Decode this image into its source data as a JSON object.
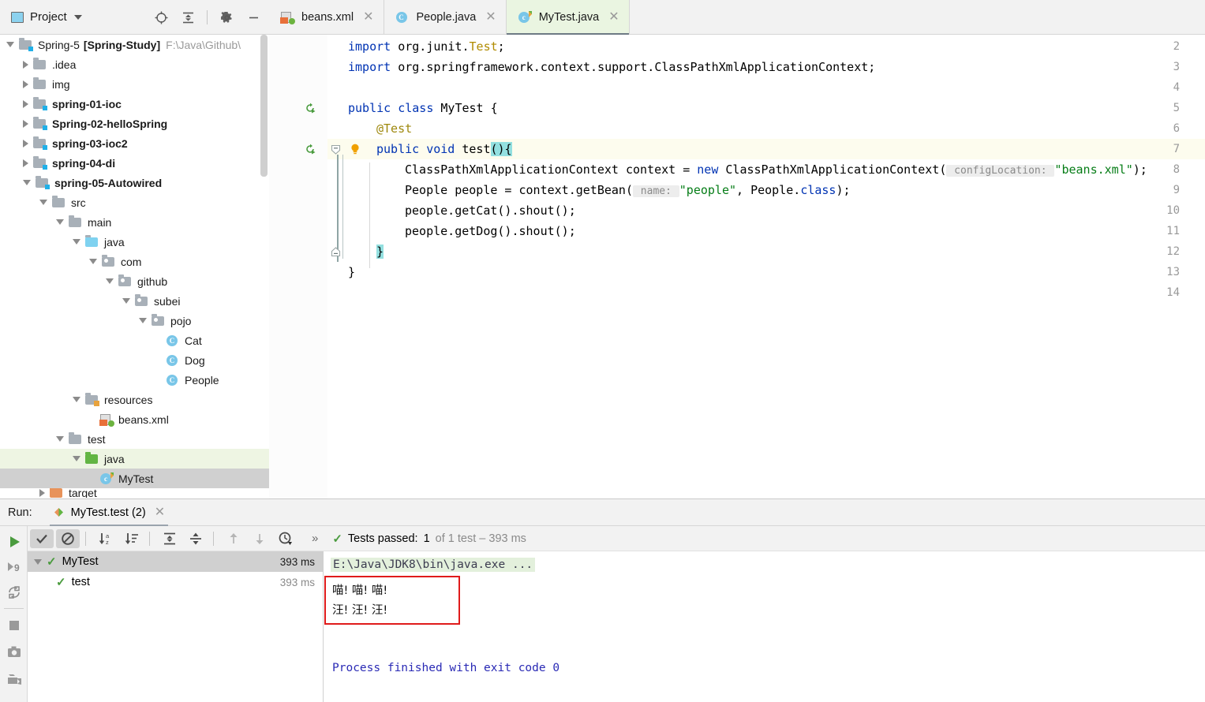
{
  "project_panel": {
    "title": "Project",
    "icons": [
      "locate-icon",
      "collapse-all-icon",
      "gear-icon",
      "minimize-icon"
    ],
    "tree": [
      {
        "depth": 0,
        "label": "Spring-5",
        "bold_label": "[Spring-Study]",
        "path": "F:\\Java\\Github\\",
        "icon": "module-folder",
        "expanded": true
      },
      {
        "depth": 1,
        "label": ".idea",
        "icon": "folder-gray",
        "expanded": false
      },
      {
        "depth": 1,
        "label": "img",
        "icon": "folder-gray",
        "expanded": false
      },
      {
        "depth": 1,
        "label": "spring-01-ioc",
        "icon": "module-folder",
        "expanded": false,
        "bold": true
      },
      {
        "depth": 1,
        "label": "Spring-02-helloSpring",
        "icon": "module-folder",
        "expanded": false,
        "bold": true
      },
      {
        "depth": 1,
        "label": "spring-03-ioc2",
        "icon": "module-folder",
        "expanded": false,
        "bold": true
      },
      {
        "depth": 1,
        "label": "spring-04-di",
        "icon": "module-folder",
        "expanded": false,
        "bold": true
      },
      {
        "depth": 1,
        "label": "spring-05-Autowired",
        "icon": "module-folder",
        "expanded": true,
        "bold": true
      },
      {
        "depth": 2,
        "label": "src",
        "icon": "folder-gray",
        "expanded": true
      },
      {
        "depth": 3,
        "label": "main",
        "icon": "folder-gray",
        "expanded": true
      },
      {
        "depth": 4,
        "label": "java",
        "icon": "folder-source-blue",
        "expanded": true
      },
      {
        "depth": 5,
        "label": "com",
        "icon": "package-icon",
        "expanded": true
      },
      {
        "depth": 6,
        "label": "github",
        "icon": "package-icon",
        "expanded": true
      },
      {
        "depth": 7,
        "label": "subei",
        "icon": "package-icon",
        "expanded": true
      },
      {
        "depth": 8,
        "label": "pojo",
        "icon": "package-icon",
        "expanded": true
      },
      {
        "depth": 9,
        "label": "Cat",
        "icon": "class-icon"
      },
      {
        "depth": 9,
        "label": "Dog",
        "icon": "class-icon"
      },
      {
        "depth": 9,
        "label": "People",
        "icon": "class-icon"
      },
      {
        "depth": 4,
        "label": "resources",
        "icon": "folder-resources",
        "expanded": true
      },
      {
        "depth": 5,
        "label": "beans.xml",
        "icon": "spring-xml-icon"
      },
      {
        "depth": 3,
        "label": "test",
        "icon": "folder-gray",
        "expanded": true
      },
      {
        "depth": 4,
        "label": "java",
        "icon": "folder-test-green",
        "expanded": true,
        "highlight": "light"
      },
      {
        "depth": 5,
        "label": "MyTest",
        "icon": "test-class-icon",
        "highlight": "selected"
      },
      {
        "depth": 2,
        "label": "target",
        "icon": "folder-excluded-orange",
        "expanded": false,
        "clipped": true
      }
    ]
  },
  "editor": {
    "tabs": [
      {
        "label": "beans.xml",
        "icon": "spring-xml-icon",
        "active": false,
        "closable": true
      },
      {
        "label": "People.java",
        "icon": "class-icon",
        "active": false,
        "closable": true
      },
      {
        "label": "MyTest.java",
        "icon": "test-class-icon",
        "active": true,
        "closable": true
      }
    ],
    "first_line_number": 2,
    "lines": [
      {
        "n": 2,
        "indent": 0,
        "tokens": [
          {
            "t": "import ",
            "c": "kw"
          },
          {
            "t": "org.junit.",
            "c": "plain"
          },
          {
            "t": "Test",
            "c": "typ"
          },
          {
            "t": ";",
            "c": "plain"
          }
        ]
      },
      {
        "n": 3,
        "indent": 0,
        "tokens": [
          {
            "t": "import ",
            "c": "kw"
          },
          {
            "t": "org.springframework.context.support.ClassPathXmlApplicationContext;",
            "c": "plain"
          }
        ]
      },
      {
        "n": 4,
        "indent": 0,
        "tokens": []
      },
      {
        "n": 5,
        "indent": 0,
        "tokens": [
          {
            "t": "public ",
            "c": "kw"
          },
          {
            "t": "class ",
            "c": "kw"
          },
          {
            "t": "MyTest {",
            "c": "plain"
          }
        ],
        "gutter_icon": "run-class-icon"
      },
      {
        "n": 6,
        "indent": 1,
        "tokens": [
          {
            "t": "@Test",
            "c": "ann"
          }
        ]
      },
      {
        "n": 7,
        "indent": 1,
        "tokens": [
          {
            "t": "public ",
            "c": "kw"
          },
          {
            "t": "void ",
            "c": "kw"
          },
          {
            "t": "test",
            "c": "plain"
          },
          {
            "t": "(){",
            "c": "brace"
          }
        ],
        "gutter_icon": "run-method-icon",
        "bulb": true,
        "caret": true,
        "fold": true
      },
      {
        "n": 8,
        "indent": 2,
        "tokens": [
          {
            "t": "ClassPathXmlApplicationContext context = ",
            "c": "plain"
          },
          {
            "t": "new ",
            "c": "kw"
          },
          {
            "t": "ClassPathXmlApplicationContext(",
            "c": "plain"
          },
          {
            "t": " configLocation: ",
            "c": "hint"
          },
          {
            "t": "\"beans.xml\"",
            "c": "str"
          },
          {
            "t": ");",
            "c": "plain"
          }
        ]
      },
      {
        "n": 9,
        "indent": 2,
        "tokens": [
          {
            "t": "People people = context.getBean(",
            "c": "plain"
          },
          {
            "t": " name: ",
            "c": "hint"
          },
          {
            "t": "\"people\"",
            "c": "str"
          },
          {
            "t": ", People.",
            "c": "plain"
          },
          {
            "t": "class",
            "c": "kw"
          },
          {
            "t": ");",
            "c": "plain"
          }
        ]
      },
      {
        "n": 10,
        "indent": 2,
        "tokens": [
          {
            "t": "people.getCat().shout();",
            "c": "plain"
          }
        ]
      },
      {
        "n": 11,
        "indent": 2,
        "tokens": [
          {
            "t": "people.getDog().shout();",
            "c": "plain"
          }
        ]
      },
      {
        "n": 12,
        "indent": 1,
        "tokens": [
          {
            "t": "}",
            "c": "brace"
          }
        ],
        "fold_end": true
      },
      {
        "n": 13,
        "indent": 0,
        "tokens": [
          {
            "t": "}",
            "c": "plain"
          }
        ]
      },
      {
        "n": 14,
        "indent": 0,
        "tokens": []
      }
    ]
  },
  "run_panel": {
    "label": "Run:",
    "tab_label": "MyTest.test (2)",
    "toolbar_icons": [
      "show-passed-icon",
      "show-ignored-icon",
      "sort-alphabetically-icon",
      "sort-by-duration-icon",
      "expand-all-icon",
      "collapse-all-icon",
      "prev-failed-icon",
      "next-failed-icon",
      "history-icon",
      "more-icon"
    ],
    "rail_icons": [
      "rerun-icon",
      "rerun-failed-icon",
      "toggle-auto-test-icon",
      "stop-icon",
      "screenshot-icon",
      "export-icon"
    ],
    "status": {
      "prefix": "Tests passed:",
      "count": "1",
      "suffix": "of 1 test – 393 ms"
    },
    "test_tree": [
      {
        "label": "MyTest",
        "time": "393 ms",
        "depth": 0,
        "selected": true,
        "expanded": true,
        "status": "passed"
      },
      {
        "label": "test",
        "time": "393 ms",
        "depth": 1,
        "selected": false,
        "status": "passed"
      }
    ],
    "console": {
      "command": "E:\\Java\\JDK8\\bin\\java.exe ...",
      "output_lines": [
        "喵! 喵! 喵!",
        "汪! 汪! 汪!"
      ],
      "exit_line": "Process finished with exit code 0",
      "highlight_color": "#e01b1b"
    }
  },
  "colors": {
    "accent_green": "#62b543",
    "keyword_blue": "#0033b3",
    "string_green": "#067d17",
    "annotation_gold": "#9e880d",
    "selection_gray": "#d0d0d0",
    "red_box": "#e01b1b"
  }
}
